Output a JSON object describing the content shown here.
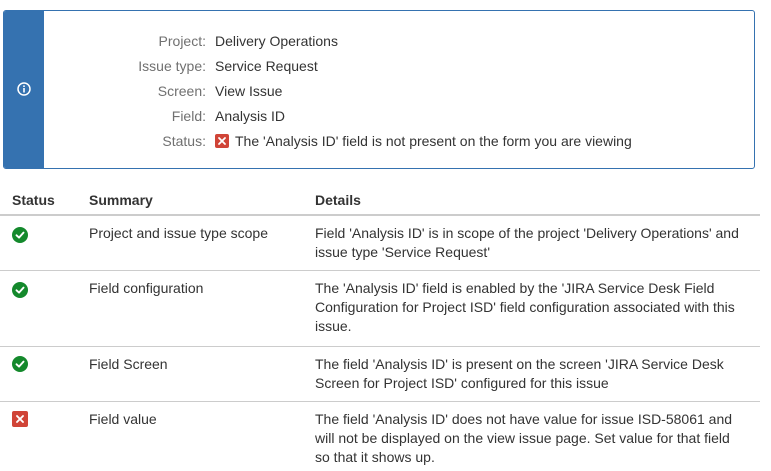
{
  "info": {
    "rows": [
      {
        "label": "Project:",
        "value": "Delivery Operations"
      },
      {
        "label": "Issue type:",
        "value": "Service Request"
      },
      {
        "label": "Screen:",
        "value": "View Issue"
      },
      {
        "label": "Field:",
        "value": "Analysis ID"
      },
      {
        "label": "Status:",
        "value": "The 'Analysis ID' field is not present on the form you are viewing",
        "icon": "error-x-icon"
      }
    ],
    "accent_color": "#3572b0",
    "icon": "info-circle-icon"
  },
  "table": {
    "headers": [
      "Status",
      "Summary",
      "Details"
    ],
    "rows": [
      {
        "status": "ok",
        "icon": "check-circle-icon",
        "summary": "Project and issue type scope",
        "details": [
          "Field 'Analysis ID' is in scope of the project 'Delivery Operations' and",
          "issue type 'Service Request'"
        ]
      },
      {
        "status": "ok",
        "icon": "check-circle-icon",
        "summary": "Field configuration",
        "details": [
          "The 'Analysis ID' field is enabled by the 'JIRA Service Desk Field",
          "Configuration for Project ISD' field configuration associated with this",
          "issue."
        ]
      },
      {
        "status": "ok",
        "icon": "check-circle-icon",
        "summary": "Field Screen",
        "details": [
          "The field 'Analysis ID' is present on the screen 'JIRA Service Desk",
          "Screen for Project ISD' configured for this issue"
        ]
      },
      {
        "status": "error",
        "icon": "error-x-icon",
        "summary": "Field value",
        "details": [
          "The field 'Analysis ID' does not have value for issue ISD-58061 and",
          "will not be displayed on the view issue page. Set value for that field",
          "so that it shows up."
        ]
      }
    ]
  },
  "colors": {
    "success": "#14892c",
    "error": "#d04437",
    "border": "#cccccc"
  }
}
